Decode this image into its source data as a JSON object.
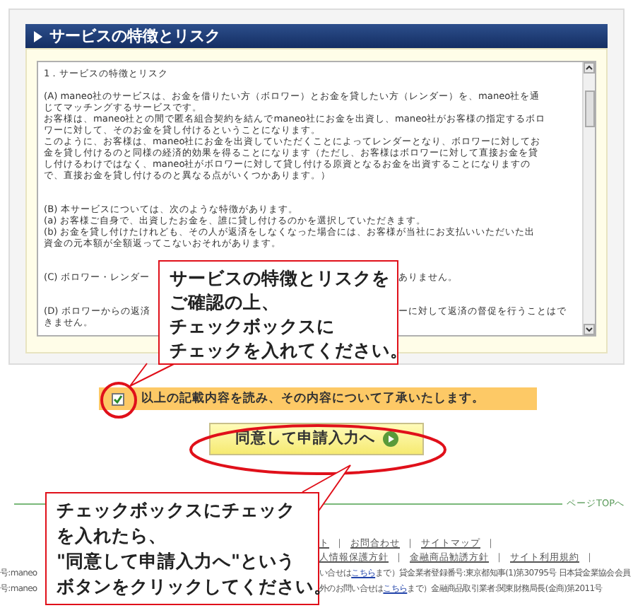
{
  "section": {
    "title": "サービスの特徴とリスク"
  },
  "terms": {
    "paragraphs": [
      {
        "lines": [
          {
            "text": "1．サービスの特徴とリスク"
          }
        ]
      },
      {
        "lines": [
          {
            "text": "(A) maneo社のサービスは、お金を借りたい方（ボロワー）とお金を貸したい方（レンダー）を、maneo社を通"
          },
          {
            "text": "じてマッチングするサービスです。"
          },
          {
            "text": "お客様は、maneo社との間で匿名組合契約を結んでmaneo社にお金を出資し、maneo社がお客様の指定するボロ"
          },
          {
            "text": "ワーに対して、そのお金を貸し付けるということになります。"
          },
          {
            "text": "このように、お客様は、maneo社にお金を出資していただくことによってレンダーとなり、ボロワーに対してお"
          },
          {
            "text": "金を貸し付けるのと同様の経済的効果を得ることになります（ただし、お客様はボロワーに対して直接お金を貸"
          },
          {
            "text": "し付けるわけではなく、maneo社がボロワーに対して貸し付ける原資となるお金を出資することになりますの"
          },
          {
            "text": "で、直接お金を貸し付けるのと異なる点がいくつかあります。）"
          }
        ]
      },
      {
        "lines": [
          {
            "text": "(B) 本サービスについては、次のような特徴があります。"
          },
          {
            "text": "(a) お客様ご自身で、出資したお金を、誰に貸し付けるのかを選択していただきます。"
          },
          {
            "text": "(b) お金を貸し付けたけれども、その人が返済をしなくなった場合には、お客様が当社にお支払いいただいた出"
          },
          {
            "text": "資金の元本額が全額返ってこないおそれがあります。"
          }
        ]
      },
      {
        "lines": [
          {
            "left": "(C) ボロワー・レンダー",
            "right": "ありません。"
          }
        ]
      },
      {
        "lines": [
          {
            "left": "(D) ボロワーからの返済",
            "right": "ーに対して返済の督促を行うことはで"
          },
          {
            "text": "きません。"
          }
        ]
      }
    ]
  },
  "agree": {
    "checked": true,
    "label": "以上の記載内容を読み、その内容について了承いたします。"
  },
  "submit_button": {
    "label": "同意して申請入力へ"
  },
  "page_top": "ページTOPへ",
  "footer": {
    "link_rows": [
      {
        "links": [
          "ト",
          "お問合わせ",
          "サイトマップ"
        ]
      },
      {
        "links": [
          "人情報保護方針",
          "金融商品勧誘方針",
          "サイト利用規約"
        ]
      }
    ],
    "separator": "｜",
    "info_rows": [
      {
        "left": "号:maneo",
        "before": "い合せは",
        "link": "こちら",
        "after": "まで）貸金業者登録番号:東京都知事(1)第30795号 日本貸金業協会会員"
      },
      {
        "left": "号:maneo",
        "before": "外のお問い合せは",
        "link": "こちら",
        "after": "まで）金融商品取引業者:関東財務局長(金商)第2011号"
      }
    ]
  },
  "callouts": [
    {
      "lines": [
        "サービスの特徴とリスクを",
        "ご確認の上、",
        "チェックボックスに",
        "チェックを入れてください。"
      ]
    },
    {
      "lines": [
        "チェックボックスにチェック",
        "を入れたら、",
        "\"同意して申請入力へ\"という",
        "ボタンをクリックしてください。"
      ]
    }
  ]
}
